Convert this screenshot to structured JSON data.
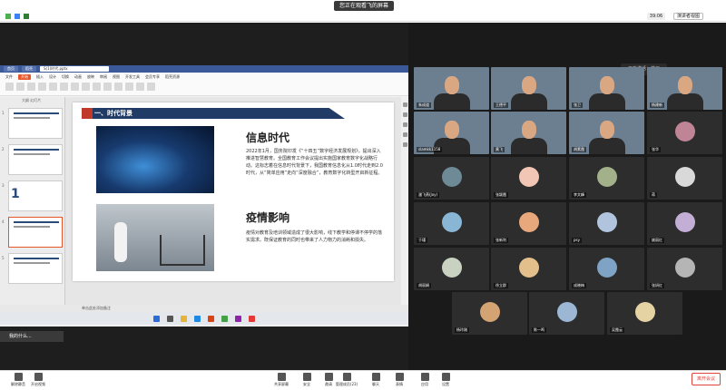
{
  "top": {
    "sharing_label": "您正在观看飞的屏幕",
    "timer": "39:06",
    "view_label": "演讲者视图"
  },
  "wps": {
    "tabs": [
      "首页",
      "稻壳",
      "S(1)时代.pptx"
    ],
    "ribbon_tabs": [
      "文件",
      "开始",
      "插入",
      "设计",
      "切换",
      "动画",
      "放映",
      "审阅",
      "视图",
      "开发工具",
      "会员专享",
      "稻壳资源"
    ],
    "thumb_header": "大纲 幻灯片",
    "thumb_numbers": [
      "1",
      "2",
      "3",
      "4",
      "5"
    ],
    "thumb_big_num": "1",
    "status_text": "幻灯片 4 / 26    Office 主题",
    "note_text": "单击此处添加备注"
  },
  "slide": {
    "header": "一、时代背景",
    "section1_title": "信息时代",
    "section1_body": "2022年1月，国务院印发《“十四五”数字经济发展规划》，提出深入推进智慧教育。全国教育工作会议提出实施国家教育数字化战略行动。这标志着在信息时代背景下，我国教育信息化从1.0时代走到2.0时代，从“简单应用”走向“深度融合”，教育数字化转型开启新征程。",
    "section2_title": "疫情影响",
    "section2_body": "疫情对教育及培训领域造成了很大影响，线下教学和停课不停学的落实需求。既保证教育的同时也带来了人力物力的消耗和损失。"
  },
  "pending": "我的什么...",
  "speaking": "正在讲话：黄飞",
  "participants": [
    {
      "name": "朱成道",
      "type": "video"
    },
    {
      "name": "王德平",
      "type": "video"
    },
    {
      "name": "张卫",
      "type": "video"
    },
    {
      "name": "杨建新",
      "type": "video"
    },
    {
      "name": "slamkk1158",
      "type": "video"
    },
    {
      "name": "黄飞",
      "type": "video"
    },
    {
      "name": "胡素霞",
      "type": "video"
    },
    {
      "name": "张华",
      "type": "avatar"
    },
    {
      "name": "潘飞燕(Joy)",
      "type": "avatar"
    },
    {
      "name": "张颖霞",
      "type": "avatar"
    },
    {
      "name": "李文峰",
      "type": "avatar"
    },
    {
      "name": "蒋",
      "type": "avatar"
    },
    {
      "name": "于瑾",
      "type": "avatar"
    },
    {
      "name": "张新利",
      "type": "avatar"
    },
    {
      "name": "psy",
      "type": "avatar"
    },
    {
      "name": "姚丽红",
      "type": "avatar"
    },
    {
      "name": "胡丽娟",
      "type": "avatar"
    },
    {
      "name": "徐立群",
      "type": "avatar"
    },
    {
      "name": "成晓梅",
      "type": "avatar"
    },
    {
      "name": "张妍红",
      "type": "avatar"
    },
    {
      "name": "杨玲刚",
      "type": "avatar"
    },
    {
      "name": "陈一鸣",
      "type": "avatar"
    },
    {
      "name": "吴霞云",
      "type": "avatar"
    }
  ],
  "bottom": {
    "unmute": "解除静音",
    "video": "开启视频",
    "share": "共享屏幕",
    "security": "安全",
    "invite": "邀请",
    "participants": "管理成员(23)",
    "chat": "聊天",
    "reactions": "表情",
    "apps": "应用",
    "settings": "设置",
    "leave": "离开会议"
  },
  "colors": {
    "accent": "#e5562b",
    "slide_header": "#1f3b66",
    "leave": "#e0443a"
  }
}
